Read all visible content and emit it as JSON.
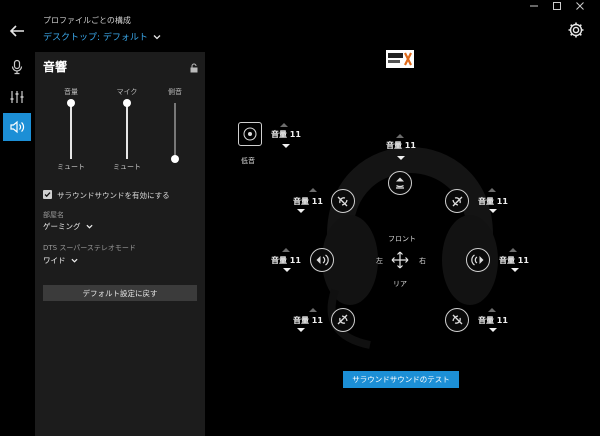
{
  "header": {
    "caption": "プロファイルごとの構成",
    "profile": "デスクトップ: デフォルト"
  },
  "panel": {
    "title": "音響",
    "columns": {
      "volume": "音量",
      "mic": "マイク",
      "sidetone": "側音"
    },
    "mute_label": "ミュート",
    "levels": {
      "volume": 1.0,
      "mic": 1.0,
      "sidetone": 0.0
    },
    "surround_enable": "サラウンドサウンドを有効にする",
    "surround_checked": true,
    "room_label": "部屋名",
    "room_value": "ゲーミング",
    "dts_label": "DTS スーパーステレオモード",
    "dts_value": "ワイド",
    "reset": "デフォルト設定に戻す"
  },
  "stage": {
    "bass_label": "低音",
    "front_label": "フロント",
    "rear_label": "リア",
    "left_label": "左",
    "right_label": "右",
    "test_button": "サラウンドサウンドのテスト",
    "dts_logo": "dts headphone:X",
    "volumes": {
      "bass": "音量 11",
      "center": "音量 11",
      "front_left": "音量 11",
      "front_right": "音量 11",
      "side_left": "音量 11",
      "side_right": "音量 11",
      "rear_left": "音量 11",
      "rear_right": "音量 11"
    }
  },
  "colors": {
    "accent": "#1c8fd6",
    "panel": "#1c1c1c",
    "background": "#000000"
  },
  "icons": [
    "back-arrow-icon",
    "chevron-down-icon",
    "gear-icon",
    "microphone-icon",
    "equalizer-icon",
    "speaker-icon",
    "lock-icon",
    "dts-logo",
    "woofer-icon",
    "move-icon"
  ]
}
